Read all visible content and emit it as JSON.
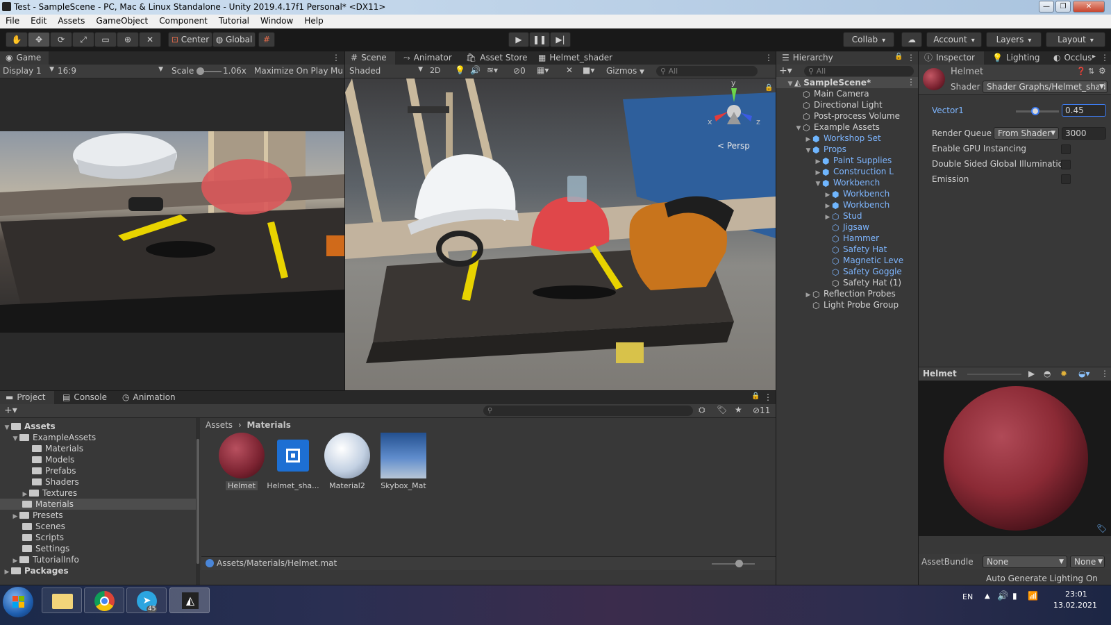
{
  "window": {
    "title": "Test - SampleScene - PC, Mac & Linux Standalone - Unity 2019.4.17f1 Personal* <DX11>"
  },
  "menu": [
    "File",
    "Edit",
    "Assets",
    "GameObject",
    "Component",
    "Tutorial",
    "Window",
    "Help"
  ],
  "toolbar": {
    "pivot_label": "Center",
    "space_label": "Global",
    "collab_label": "Collab",
    "account_label": "Account",
    "layers_label": "Layers",
    "layout_label": "Layout"
  },
  "game": {
    "tab": "Game",
    "display": "Display 1",
    "aspect": "16:9",
    "scale_label": "Scale",
    "scale_value": "1.06x",
    "maximize": "Maximize On Play",
    "mute": "Mu"
  },
  "scene": {
    "tabs": [
      "Scene",
      "Animator",
      "Asset Store",
      "Helmet_shader"
    ],
    "shading": "Shaded",
    "mode_2d": "2D",
    "hidden_count": "0",
    "gizmos": "Gizmos",
    "search_placeholder": "All",
    "persp": "Persp",
    "axis_x": "x",
    "axis_y": "y",
    "axis_z": "z"
  },
  "hierarchy": {
    "tab": "Hierarchy",
    "search_placeholder": "All",
    "scene_name": "SampleScene*",
    "items": [
      {
        "label": "Main Camera"
      },
      {
        "label": "Directional Light"
      },
      {
        "label": "Post-process Volume"
      },
      {
        "label": "Example Assets"
      },
      {
        "label": "Workshop Set"
      },
      {
        "label": "Props"
      },
      {
        "label": "Paint Supplies"
      },
      {
        "label": "Construction L"
      },
      {
        "label": "Workbench"
      },
      {
        "label": "Workbench"
      },
      {
        "label": "Workbench"
      },
      {
        "label": "Stud"
      },
      {
        "label": "Jigsaw"
      },
      {
        "label": "Hammer"
      },
      {
        "label": "Safety Hat"
      },
      {
        "label": "Magnetic Leve"
      },
      {
        "label": "Safety Goggle"
      },
      {
        "label": "Safety Hat (1)"
      },
      {
        "label": "Reflection Probes"
      },
      {
        "label": "Light Probe Group"
      }
    ]
  },
  "inspector": {
    "tabs": [
      "Inspector",
      "Lighting",
      "Occlus"
    ],
    "object_name": "Helmet",
    "shader_label": "Shader",
    "shader_value": "Shader Graphs/Helmet_shad",
    "vector1_label": "Vector1",
    "vector1_value": "0.45",
    "vector1_slider": 0.45,
    "render_queue_label": "Render Queue",
    "render_queue_mode": "From Shader",
    "render_queue_value": "3000",
    "gpu_instancing_label": "Enable GPU Instancing",
    "double_sided_label": "Double Sided Global Illumination",
    "emission_label": "Emission",
    "preview_title": "Helmet",
    "assetbundle_label": "AssetBundle",
    "assetbundle_value": "None",
    "assetbundle_variant": "None",
    "status": "Auto Generate Lighting On",
    "material_color": "#8b2a35"
  },
  "project": {
    "tabs": [
      "Project",
      "Console",
      "Animation"
    ],
    "hidden_count": "11",
    "tree": [
      {
        "label": "Assets"
      },
      {
        "label": "ExampleAssets"
      },
      {
        "label": "Materials"
      },
      {
        "label": "Models"
      },
      {
        "label": "Prefabs"
      },
      {
        "label": "Shaders"
      },
      {
        "label": "Textures"
      },
      {
        "label": "Materials"
      },
      {
        "label": "Presets"
      },
      {
        "label": "Scenes"
      },
      {
        "label": "Scripts"
      },
      {
        "label": "Settings"
      },
      {
        "label": "TutorialInfo"
      },
      {
        "label": "Packages"
      }
    ],
    "breadcrumb": [
      "Assets",
      "Materials"
    ],
    "assets": [
      {
        "label": "Helmet"
      },
      {
        "label": "Helmet_sha..."
      },
      {
        "label": "Material2"
      },
      {
        "label": "Skybox_Mat"
      }
    ],
    "path": "Assets/Materials/Helmet.mat"
  },
  "taskbar": {
    "lang": "EN",
    "time": "23:01",
    "date": "13.02.2021",
    "telegram_badge": "45"
  }
}
